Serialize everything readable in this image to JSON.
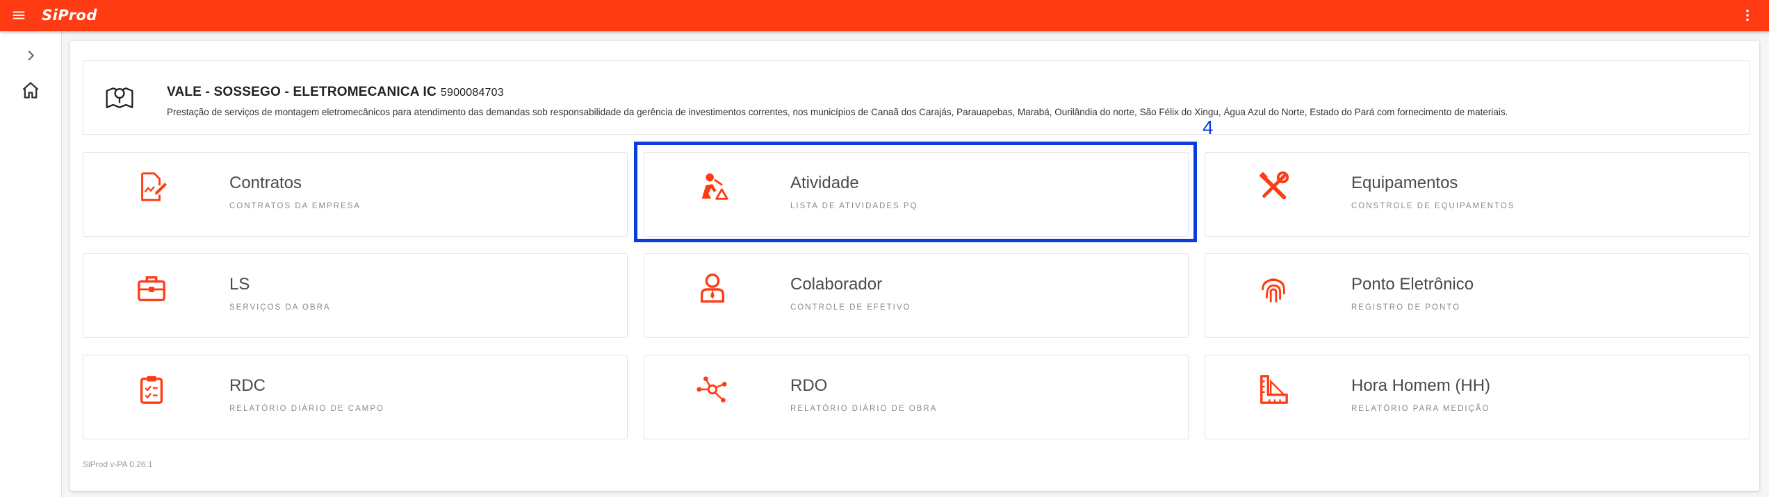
{
  "app": {
    "brand": "SiProd"
  },
  "header": {
    "title": "VALE - SOSSEGO - ELETROMECANICA IC",
    "code": "5900084703",
    "description": "Prestação de serviços de montagem eletromecânicos para atendimento das demandas sob responsabilidade da gerência de investimentos correntes, nos municípios de Canaã dos Carajás, Parauapebas, Marabá, Ourilândia do norte, São Félix do Xingu, Água Azul do Norte, Estado do Pará com fornecimento de materiais."
  },
  "tiles": [
    {
      "title": "Contratos",
      "subtitle": "CONTRATOS DA EMPRESA",
      "icon": "contract-edit-icon"
    },
    {
      "title": "Atividade",
      "subtitle": "LISTA DE ATIVIDADES PQ",
      "icon": "construction-worker-icon"
    },
    {
      "title": "Equipamentos",
      "subtitle": "CONSTROLE DE EQUIPAMENTOS",
      "icon": "tools-icon"
    },
    {
      "title": "LS",
      "subtitle": "SERVIÇOS DA OBRA",
      "icon": "briefcase-icon"
    },
    {
      "title": "Colaborador",
      "subtitle": "CONTROLE DE EFETIVO",
      "icon": "person-icon"
    },
    {
      "title": "Ponto Eletrônico",
      "subtitle": "REGISTRO DE PONTO",
      "icon": "fingerprint-icon"
    },
    {
      "title": "RDC",
      "subtitle": "RELATÓRIO DIÁRIO DE CAMPO",
      "icon": "clipboard-check-icon"
    },
    {
      "title": "RDO",
      "subtitle": "RELATÓRIO DIÁRIO DE OBRA",
      "icon": "network-icon"
    },
    {
      "title": "Hora Homem (HH)",
      "subtitle": "RELATÓRIO PARA MEDIÇÃO",
      "icon": "ruler-icon"
    }
  ],
  "annotation": {
    "label": "4"
  },
  "footer": {
    "version": "SiProd v-PA 0.26.1"
  },
  "colors": {
    "accent": "#ff3b14",
    "highlight": "#0a3de0"
  }
}
